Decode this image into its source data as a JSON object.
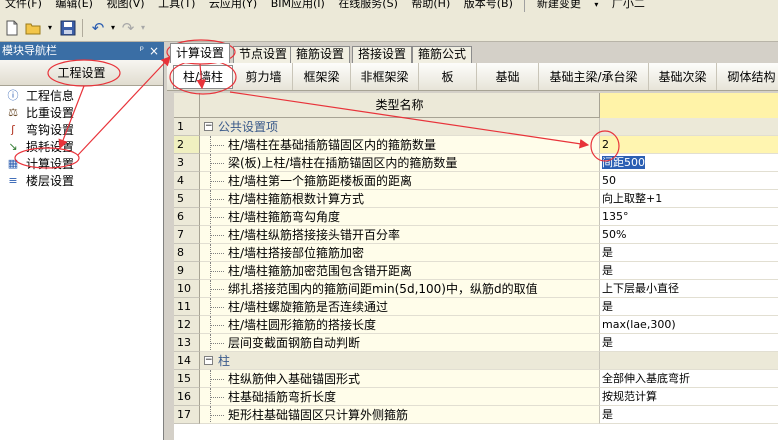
{
  "menubar": {
    "items": [
      "文件(F)",
      "编辑(E)",
      "视图(V)",
      "工具(T)",
      "云应用(Y)",
      "BIM应用(I)",
      "在线服务(S)",
      "帮助(H)",
      "版本号(B)",
      "新建变更",
      "广小二"
    ]
  },
  "toolbar": {
    "icons": [
      "new-file-icon",
      "open-folder-icon",
      "save-icon",
      "undo-icon",
      "redo-icon"
    ]
  },
  "nav": {
    "header": "模块导航栏",
    "pin_glyph": "ᵖ",
    "close_glyph": "×",
    "panel_title": "工程设置",
    "items": [
      {
        "label": "工程信息",
        "icon": "info-icon",
        "glyph": "ⓘ"
      },
      {
        "label": "比重设置",
        "icon": "weight-icon",
        "glyph": "⚖"
      },
      {
        "label": "弯钩设置",
        "icon": "hook-icon",
        "glyph": "ʃ"
      },
      {
        "label": "损耗设置",
        "icon": "loss-icon",
        "glyph": "↘"
      },
      {
        "label": "计算设置",
        "icon": "calc-icon",
        "glyph": "▦"
      },
      {
        "label": "楼层设置",
        "icon": "floor-icon",
        "glyph": "≡"
      }
    ]
  },
  "tabs": {
    "items": [
      "计算设置",
      "节点设置",
      "箍筋设置",
      "搭接设置",
      "箍筋公式"
    ],
    "active": 0
  },
  "subtabs": {
    "items": [
      "柱/墙柱",
      "剪力墙",
      "框架梁",
      "非框架梁",
      "板",
      "基础",
      "基础主梁/承台梁",
      "基础次梁",
      "砌体结构"
    ],
    "active": 0
  },
  "grid": {
    "header_name": "类型名称",
    "rows": [
      {
        "n": "1",
        "group": true,
        "name": "公共设置项",
        "value": ""
      },
      {
        "n": "2",
        "name": "柱/墙柱在基础插筋锚固区内的箍筋数量",
        "value": "2",
        "selected": true
      },
      {
        "n": "3",
        "name": "梁(板)上柱/墙柱在插筋锚固区内的箍筋数量",
        "value": "间距500",
        "highlight": true
      },
      {
        "n": "4",
        "name": "柱/墙柱第一个箍筋距楼板面的距离",
        "value": "50"
      },
      {
        "n": "5",
        "name": "柱/墙柱箍筋根数计算方式",
        "value": "向上取整+1"
      },
      {
        "n": "6",
        "name": "柱/墙柱箍筋弯勾角度",
        "value": "135°"
      },
      {
        "n": "7",
        "name": "柱/墙柱纵筋搭接接头错开百分率",
        "value": "50%"
      },
      {
        "n": "8",
        "name": "柱/墙柱搭接部位箍筋加密",
        "value": "是"
      },
      {
        "n": "9",
        "name": "柱/墙柱箍筋加密范围包含错开距离",
        "value": "是"
      },
      {
        "n": "10",
        "name": "绑扎搭接范围内的箍筋间距min(5d,100)中，纵筋d的取值",
        "value": "上下层最小直径"
      },
      {
        "n": "11",
        "name": "柱/墙柱螺旋箍筋是否连续通过",
        "value": "是"
      },
      {
        "n": "12",
        "name": "柱/墙柱圆形箍筋的搭接长度",
        "value": "max(lae,300)"
      },
      {
        "n": "13",
        "name": "层间变截面钢筋自动判断",
        "value": "是"
      },
      {
        "n": "14",
        "group": true,
        "name": "柱",
        "value": ""
      },
      {
        "n": "15",
        "name": "柱纵筋伸入基础锚固形式",
        "value": "全部伸入基底弯折"
      },
      {
        "n": "16",
        "name": "柱基础插筋弯折长度",
        "value": "按规范计算"
      },
      {
        "n": "17",
        "name": "矩形柱基础锚固区只计算外侧箍筋",
        "value": "是"
      }
    ]
  },
  "colors": {
    "annotation": "#e8333a",
    "header_value_bg": "#fff3a8",
    "nav_header_bg": "#3a6ea5"
  }
}
